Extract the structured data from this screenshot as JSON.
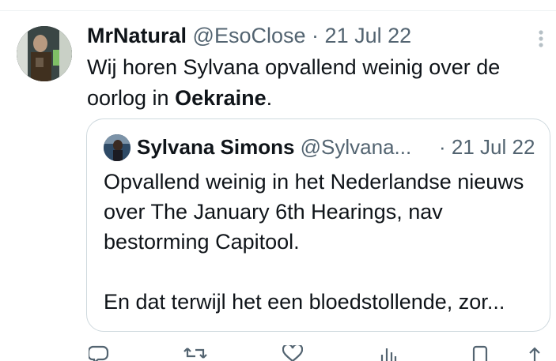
{
  "tweet": {
    "display_name": "MrNatural",
    "handle": "@EsoClose",
    "separator": "·",
    "date": "21 Jul 22",
    "text_before": "Wij horen Sylvana opvallend weinig over de oorlog in ",
    "text_bold": "Oekraine",
    "text_after": "."
  },
  "quote": {
    "display_name": "Sylvana Simons",
    "handle": "@Sylvana...",
    "date": "· 21 Jul 22",
    "paragraph_1": "Opvallend weinig in het Nederlandse nieuws over The January 6th Hearings, nav bestorming Capitool.",
    "paragraph_2": "En dat terwijl het een bloedstollende, zor..."
  },
  "icons": {
    "more": "more-vertical-icon",
    "reply": "reply-icon",
    "retweet": "retweet-icon",
    "like": "heart-icon",
    "views": "views-icon",
    "bookmark": "bookmark-icon",
    "share": "share-icon"
  },
  "colors": {
    "text": "#0f1419",
    "secondary": "#536471",
    "border": "#cfd9de"
  }
}
